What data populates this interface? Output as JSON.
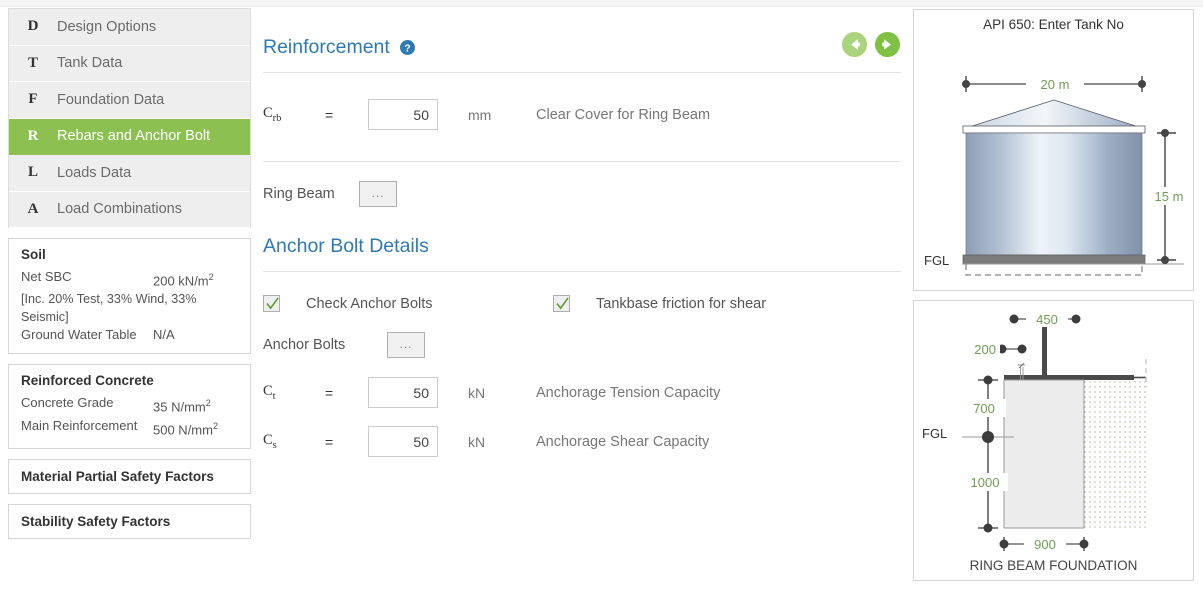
{
  "sidebar": {
    "nav": [
      {
        "letter": "D",
        "label": "Design Options",
        "active": false
      },
      {
        "letter": "T",
        "label": "Tank Data",
        "active": false
      },
      {
        "letter": "F",
        "label": "Foundation Data",
        "active": false
      },
      {
        "letter": "R",
        "label": "Rebars and Anchor Bolt",
        "active": true
      },
      {
        "letter": "L",
        "label": "Loads Data",
        "active": false
      },
      {
        "letter": "A",
        "label": "Load Combinations",
        "active": false
      }
    ],
    "soil": {
      "title": "Soil",
      "net_sbc_label": "Net SBC",
      "net_sbc_value": "200 kN/m",
      "net_sbc_sup": "2",
      "note": "[Inc. 20% Test, 33% Wind, 33% Seismic]",
      "gwt_label": "Ground Water Table",
      "gwt_value": "N/A"
    },
    "concrete": {
      "title": "Reinforced Concrete",
      "grade_label": "Concrete Grade",
      "grade_value": "35 N/mm",
      "grade_sup": "2",
      "rebar_label": "Main Reinforcement",
      "rebar_value": "500 N/mm",
      "rebar_sup": "2"
    },
    "material_factors_label": "Material Partial Safety Factors",
    "stability_factors_label": "Stability Safety Factors"
  },
  "main": {
    "reinforcement": {
      "title": "Reinforcement",
      "help_icon": "question-circle-icon",
      "prev_icon": "arrow-left-circle-icon",
      "next_icon": "arrow-right-circle-icon",
      "crb": {
        "symbol": "C",
        "subscript": "rb",
        "equals": "=",
        "value": "50",
        "unit": "mm",
        "description": "Clear Cover for Ring Beam"
      },
      "ring_beam_label": "Ring Beam",
      "ring_beam_button": "..."
    },
    "anchor": {
      "title": "Anchor Bolt Details",
      "check_anchor_bolts_label": "Check Anchor Bolts",
      "check_anchor_bolts_checked": true,
      "tankbase_friction_label": "Tankbase friction for shear",
      "tankbase_friction_checked": true,
      "anchor_bolts_label": "Anchor Bolts",
      "anchor_bolts_button": "...",
      "ct": {
        "symbol": "C",
        "subscript": "t",
        "equals": "=",
        "value": "50",
        "unit": "kN",
        "description": "Anchorage Tension Capacity"
      },
      "cs": {
        "symbol": "C",
        "subscript": "s",
        "equals": "=",
        "value": "50",
        "unit": "kN",
        "description": "Anchorage Shear Capacity"
      }
    }
  },
  "diagrams": {
    "tank": {
      "title": "API 650: Enter Tank No",
      "diameter": "20 m",
      "height": "15 m",
      "ground_label": "FGL"
    },
    "foundation": {
      "caption": "RING BEAM FOUNDATION",
      "top_dim": "450",
      "edge_dim": "200",
      "upper_depth": "700",
      "lower_depth": "1000",
      "width": "900",
      "ground_label": "FGL"
    }
  },
  "colors": {
    "accent_green": "#8cc152",
    "title_blue": "#2f7ab5",
    "dim_green": "#6f9e53",
    "panel_border": "#d5d5d5"
  }
}
